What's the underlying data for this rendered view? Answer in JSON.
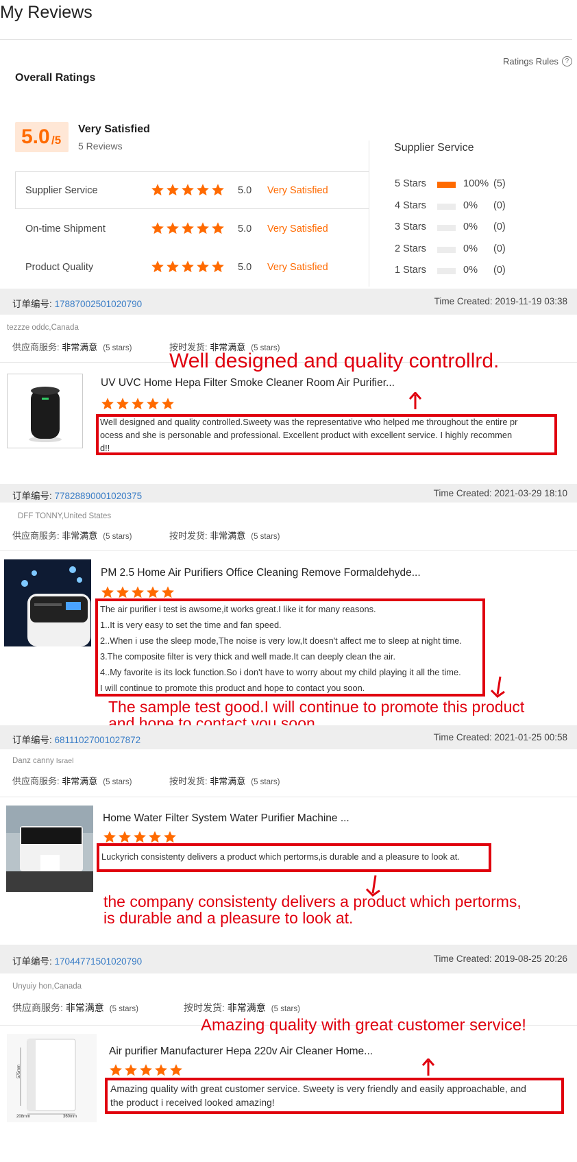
{
  "page": {
    "title": "My Reviews"
  },
  "ratings_rules": {
    "label": "Ratings Rules",
    "icon": "question-circle-icon"
  },
  "overall": {
    "title": "Overall Ratings",
    "score": "5.0",
    "score_suffix": "/5",
    "verdict": "Very Satisfied",
    "reviews": "5 Reviews",
    "rows": [
      {
        "label": "Supplier Service",
        "value": "5.0",
        "verdict": "Very Satisfied",
        "stars": 5
      },
      {
        "label": "On-time Shipment",
        "value": "5.0",
        "verdict": "Very Satisfied",
        "stars": 5
      },
      {
        "label": "Product Quality",
        "value": "5.0",
        "verdict": "Very Satisfied",
        "stars": 5
      }
    ]
  },
  "distribution": {
    "title": "Supplier Service",
    "rows": [
      {
        "label": "5 Stars",
        "percent": "100%",
        "count": "(5)",
        "fraction": 1.0
      },
      {
        "label": "4 Stars",
        "percent": "0%",
        "count": "(0)",
        "fraction": 0
      },
      {
        "label": "3 Stars",
        "percent": "0%",
        "count": "(0)",
        "fraction": 0
      },
      {
        "label": "2 Stars",
        "percent": "0%",
        "count": "(0)",
        "fraction": 0
      },
      {
        "label": "1 Stars",
        "percent": "0%",
        "count": "(0)",
        "fraction": 0
      }
    ]
  },
  "labels": {
    "order_no": "订单编号: ",
    "supplier_service": "供应商服务: ",
    "on_time": "按时发货: ",
    "very_satisfied_cn": "非常满意",
    "five_stars": "(5 stars)"
  },
  "orders": [
    {
      "order_id": "17887002501020790",
      "time": "Time Created: 2019-11-19 03:38",
      "buyer": "tezzze oddc,Canada",
      "product": "UV UVC Home Hepa Filter Smoke Cleaner Room Air Purifier...",
      "stars": 5,
      "review_lines": [
        "Well designed and quality controlled.Sweety was the representative who helped me throughout the entire pr",
        "ocess and she is personable and professional. Excellent product with excellent service. I highly recommen",
        "d!!"
      ],
      "annotation_lines": [
        "Well designed and quality controllrd."
      ]
    },
    {
      "order_id": "77828890001020375",
      "time": "Time Created: 2021-03-29 18:10",
      "buyer": "DFF TONNY,United States",
      "product": "PM 2.5 Home Air Purifiers Office Cleaning Remove Formaldehyde...",
      "stars": 5,
      "review_lines": [
        "The air purifier i test  is awsome,it works great.I like it for many reasons.",
        "1..It is very easy to set the time and fan speed.",
        "2..When i use the sleep mode,The noise is very low,It doesn't affect me to sleep at night time.",
        "3.The composite filter is very thick and well made.It can deeply clean the air.",
        "4..My favorite is its lock function.So i don't have to worry about my child playing it all the time.",
        "I will continue to promote this product and hope to contact you soon."
      ],
      "annotation_lines": [
        "The sample test good.I will continue to promote this product",
        "and hope to contact you soon."
      ]
    },
    {
      "order_id": "68111027001027872",
      "time": "Time Created: 2021-01-25 00:58",
      "buyer": "Danz canny",
      "buyer_country": "Israel",
      "product": "Home Water Filter System Water Purifier Machine ...",
      "stars": 5,
      "review_lines": [
        "Luckyrich consistenty delivers a product which pertorms,is durable and a pleasure to look at."
      ],
      "annotation_lines": [
        "the company consistenty delivers a product which pertorms,",
        "is durable and a pleasure to look at."
      ]
    },
    {
      "order_id": "17044771501020790",
      "time": "Time Created: 2019-08-25 20:26",
      "buyer": "Unyuiy hon,Canada",
      "product": "Air purifier Manufacturer Hepa 220v Air Cleaner Home...",
      "stars": 5,
      "review_lines": [
        "Amazing quality with great customer service. Sweety is very friendly and easily approachable, and",
        "the product i received looked amazing!"
      ],
      "annotation_lines": [
        "Amazing quality with great customer service!"
      ],
      "image_text": {
        "height": "575mm",
        "width": "360mm",
        "depth": "208mm"
      }
    }
  ],
  "colors": {
    "accent": "#ff6a00",
    "link": "#3a7dc6",
    "annotation": "#e0000e",
    "score_bg": "#ffe7d6"
  }
}
